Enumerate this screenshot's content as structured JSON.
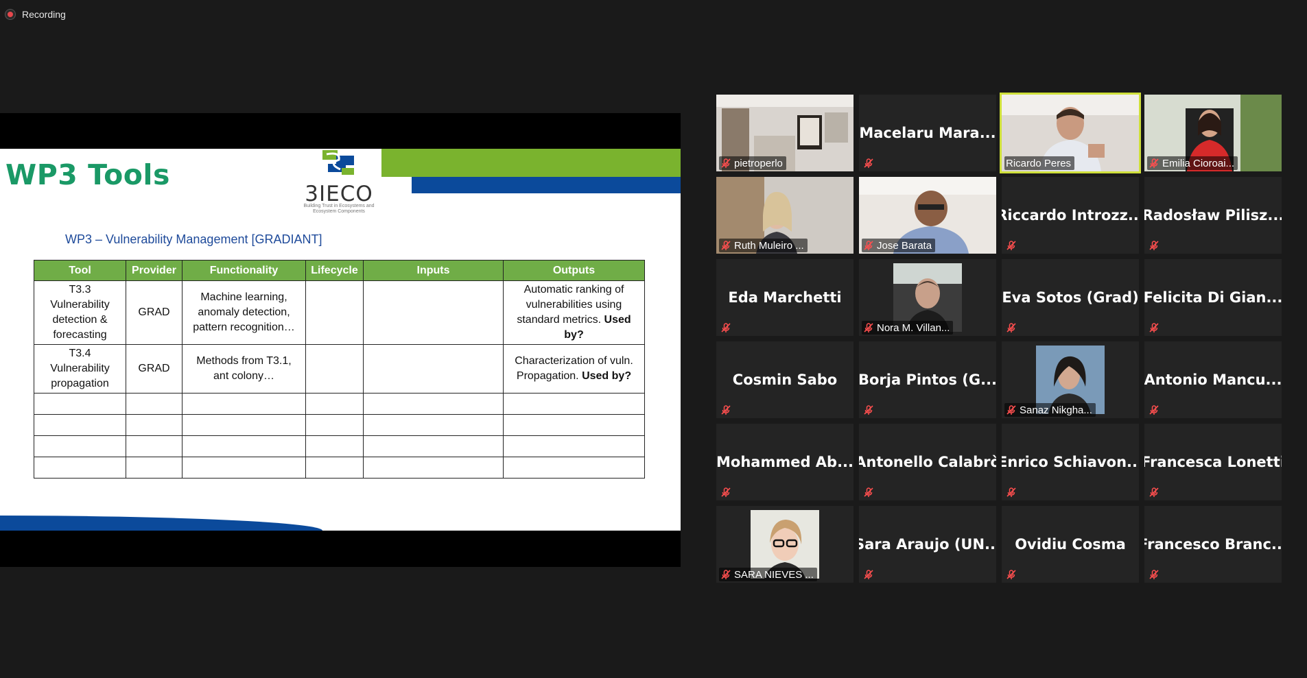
{
  "recording": {
    "label": "Recording"
  },
  "slide": {
    "title": "WP3 Tools",
    "logo_text": "3IECO",
    "logo_sub": "Building Trust in Ecosystems and Ecosystem Components",
    "subtitle": "WP3 – Vulnerability Management [GRADIANT]",
    "table": {
      "headers": [
        "Tool",
        "Provider",
        "Functionality",
        "Lifecycle",
        "Inputs",
        "Outputs"
      ],
      "rows": [
        {
          "tool": [
            "T3.3",
            "Vulnerability",
            "detection &",
            "forecasting"
          ],
          "provider": "GRAD",
          "functionality": [
            "Machine learning,",
            "anomaly detection,",
            "pattern recognition…"
          ],
          "lifecycle": "",
          "inputs": "",
          "outputs_plain": [
            "Automatic ranking of",
            "vulnerabilities using",
            "standard metrics."
          ],
          "outputs_bold": "Used by?"
        },
        {
          "tool": [
            "T3.4",
            "Vulnerability",
            "propagation"
          ],
          "provider": "GRAD",
          "functionality": [
            "Methods from T3.1,",
            "ant colony…"
          ],
          "lifecycle": "",
          "inputs": "",
          "outputs_plain": [
            "Characterization of vuln.",
            "Propagation."
          ],
          "outputs_bold": "Used by?"
        }
      ],
      "empty_rows": 4
    }
  },
  "participants": [
    {
      "name": "pietroperlo",
      "mode": "video",
      "scene": "room",
      "muted": true
    },
    {
      "name": "Macelaru  Mara...",
      "mode": "name",
      "muted": true
    },
    {
      "name": "Ricardo Peres",
      "mode": "video",
      "scene": "man",
      "muted": false,
      "speaking": true
    },
    {
      "name": "Emilia Cioroai...",
      "mode": "video",
      "scene": "woman-red",
      "muted": true
    },
    {
      "name": "Ruth Muleiro ...",
      "mode": "video",
      "scene": "woman-blond",
      "muted": true
    },
    {
      "name": "Jose Barata",
      "mode": "video",
      "scene": "man-bald",
      "muted": true
    },
    {
      "name": "Riccardo  Introzz...",
      "mode": "name",
      "muted": true
    },
    {
      "name": "Radosław  Pilisz...",
      "mode": "name",
      "muted": true
    },
    {
      "name": "Eda Marchetti",
      "mode": "name",
      "muted": true
    },
    {
      "name": "Nora M. Villan...",
      "mode": "photo",
      "scene": "nora",
      "muted": true
    },
    {
      "name": "Eva Sotos (Grad)",
      "mode": "name",
      "muted": true
    },
    {
      "name": "Felicita  Di Gian...",
      "mode": "name",
      "muted": true
    },
    {
      "name": "Cosmin Sabo",
      "mode": "name",
      "muted": true
    },
    {
      "name": "Borja Pintos (G...",
      "mode": "name",
      "muted": true
    },
    {
      "name": "Sanaz Nikgha...",
      "mode": "photo",
      "scene": "sanaz",
      "muted": true
    },
    {
      "name": "Antonio  Mancu...",
      "mode": "name",
      "muted": true
    },
    {
      "name": "Mohammed  Ab...",
      "mode": "name",
      "muted": true
    },
    {
      "name": "Antonello Calabrò",
      "mode": "name",
      "muted": true
    },
    {
      "name": "Enrico  Schiavon...",
      "mode": "name",
      "muted": true
    },
    {
      "name": "Francesca Lonetti",
      "mode": "name",
      "muted": true
    },
    {
      "name": "SARA NIEVES ...",
      "mode": "photo",
      "scene": "sara",
      "muted": true
    },
    {
      "name": "Sara Araujo (UN...",
      "mode": "name",
      "muted": true
    },
    {
      "name": "Ovidiu Cosma",
      "mode": "name",
      "muted": true
    },
    {
      "name": "Francesco  Branc...",
      "mode": "name",
      "muted": true
    }
  ]
}
